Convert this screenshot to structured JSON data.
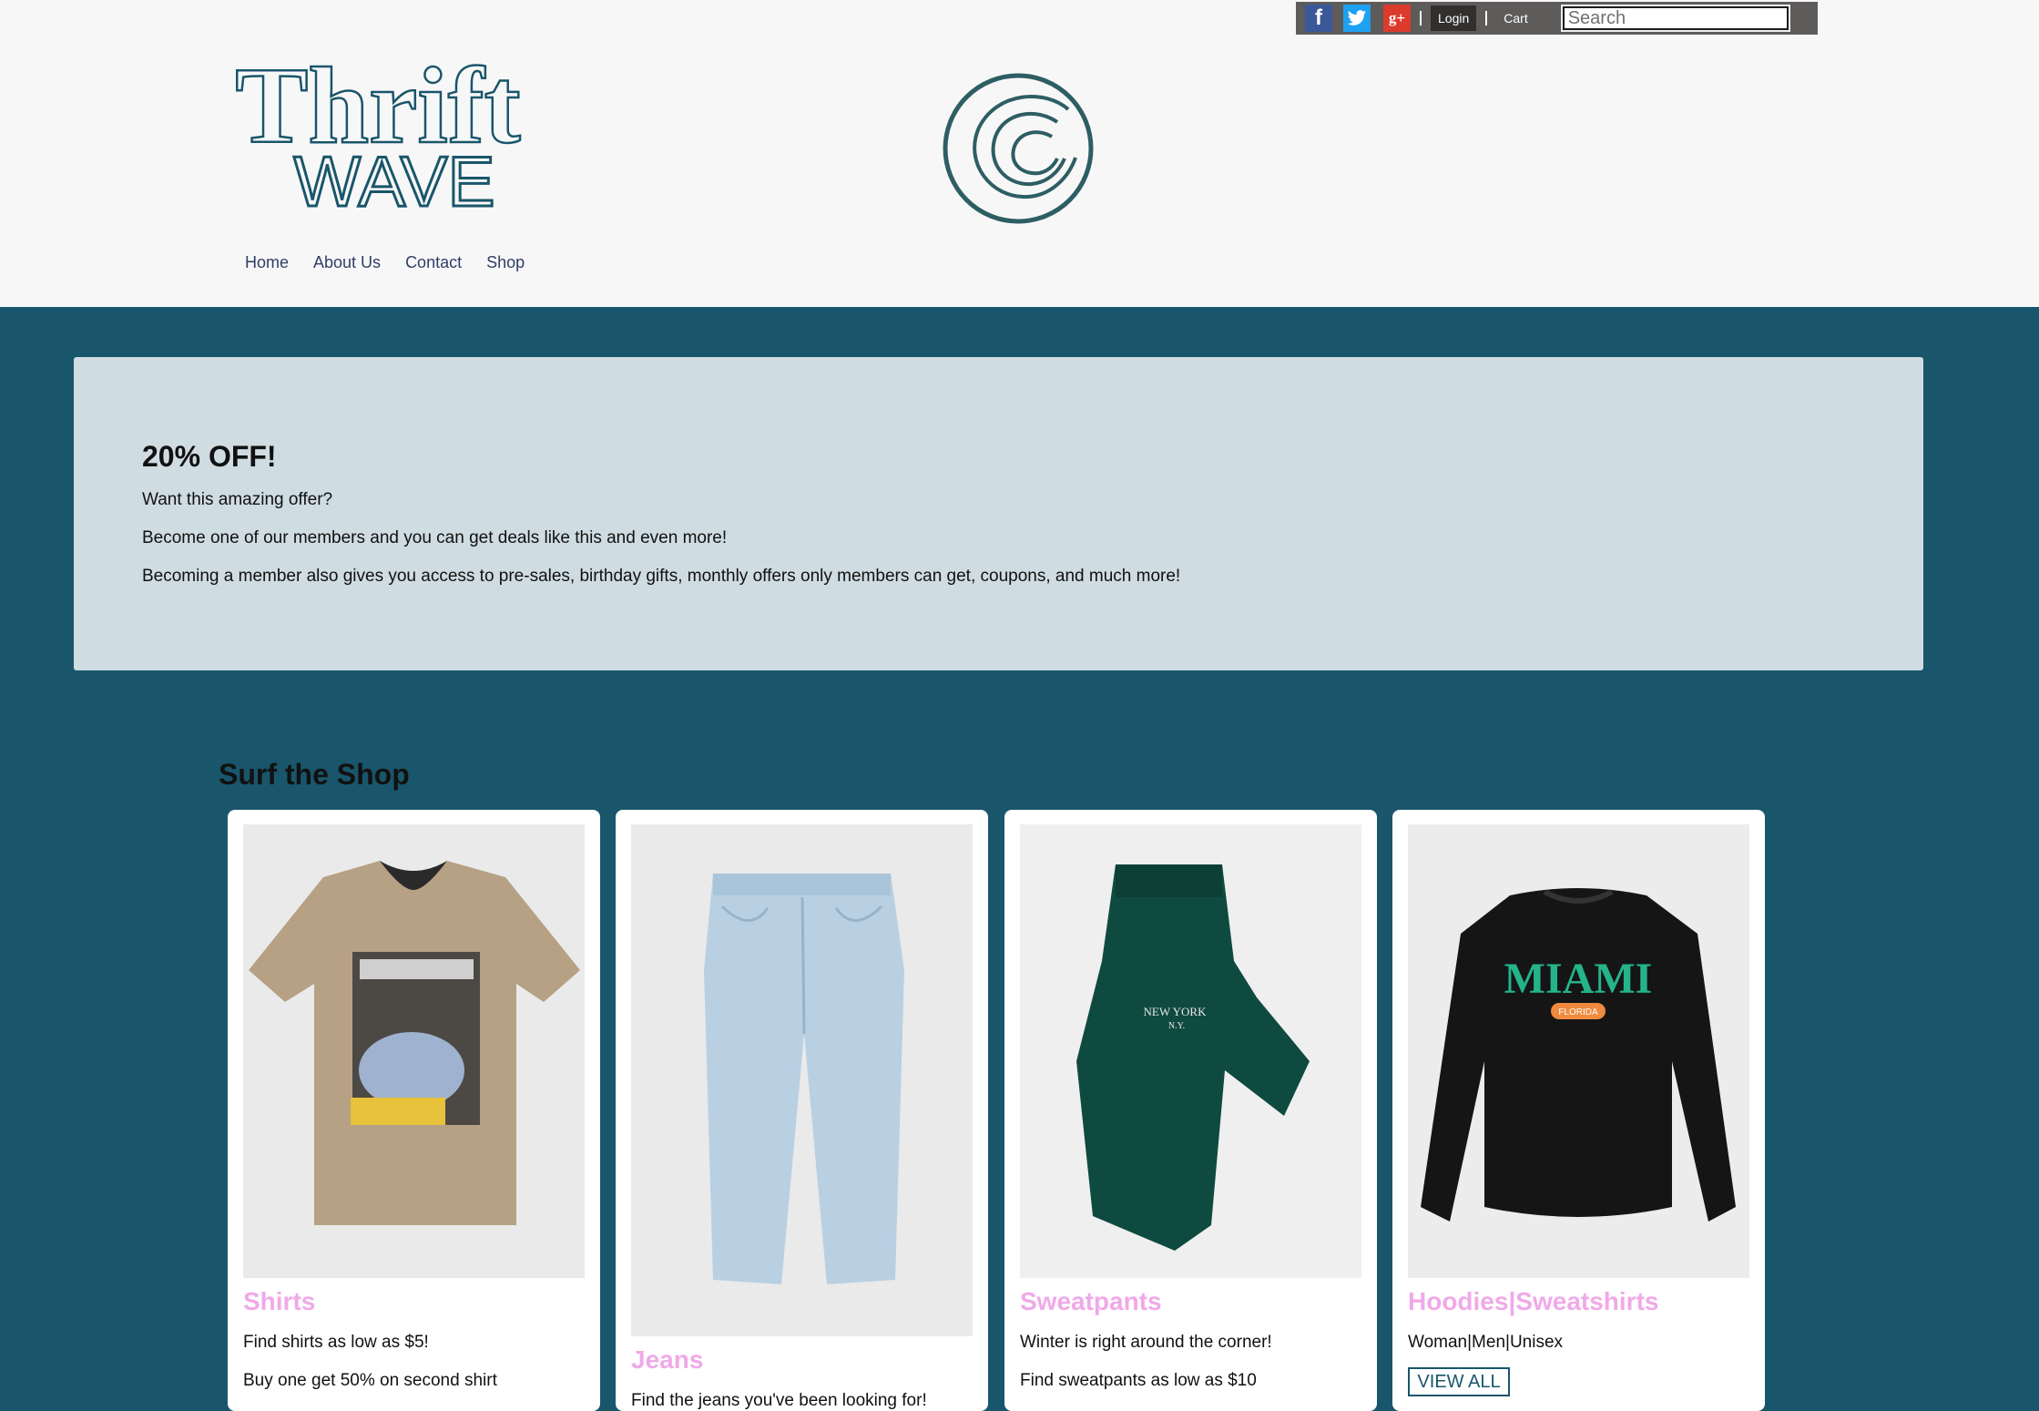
{
  "header": {
    "logo": {
      "line1": "Thrift",
      "line2": "WAVE"
    },
    "topbar": {
      "social": [
        {
          "name": "facebook-icon",
          "glyph": "f"
        },
        {
          "name": "twitter-icon",
          "glyph": "🐦"
        },
        {
          "name": "google-plus-icon",
          "glyph": "g+"
        }
      ],
      "login_label": "Login",
      "cart_label": "Cart",
      "search_placeholder": "Search"
    },
    "nav": [
      "Home",
      "About Us",
      "Contact",
      "Shop"
    ]
  },
  "promo": {
    "title": "20% OFF!",
    "lines": [
      "Want this amazing offer?",
      "Become one of our members and you can get deals like this and even more!",
      "Becoming a member also gives you access to pre-sales, birthday gifts, monthly offers only members can get, coupons, and much more!"
    ]
  },
  "shop": {
    "title": "Surf the Shop",
    "cards": [
      {
        "title": "Shirts",
        "lines": [
          "Find shirts as low as $5!",
          "Buy one get 50% on second shirt"
        ],
        "image": "tshirt-new-york"
      },
      {
        "title": "Jeans",
        "lines": [
          "Find the jeans you've been looking for!"
        ],
        "image": "light-blue-jeans"
      },
      {
        "title": "Sweatpants",
        "lines": [
          "Winter is right around the corner!",
          "Find sweatpants as low as $10"
        ],
        "image": "green-sweatpants"
      },
      {
        "title": "Hoodies|Sweatshirts",
        "lines": [
          "Woman|Men|Unisex"
        ],
        "button": "VIEW ALL",
        "image": "black-miami-sweatshirt",
        "shirt_text": "MIAMI",
        "badge_text": "FLORIDA"
      }
    ]
  },
  "colors": {
    "teal": "#19566b",
    "header_bg": "#f8f7f7",
    "promo_bg": "#cfdce1",
    "pink": "#f0a9e8"
  }
}
